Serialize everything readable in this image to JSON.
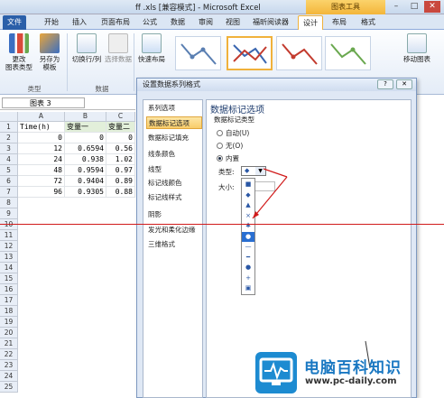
{
  "window": {
    "title": "ff .xls [兼容模式] - Microsoft Excel",
    "chart_tools": "图表工具",
    "minimize": "–",
    "maximize": "□",
    "close": "✕"
  },
  "ribbon_tabs": [
    "文件",
    "开始",
    "插入",
    "页面布局",
    "公式",
    "数据",
    "审阅",
    "视图",
    "福昕阅读器",
    "设计",
    "布局",
    "格式"
  ],
  "ribbon": {
    "change_type": "更改\n图表类型",
    "save_template": "另存为\n模板",
    "switch_rowcol": "切换行/列",
    "select_data": "选择数据",
    "quick_layout": "快速布局",
    "move_chart": "移动图表",
    "group_type": "类型",
    "group_data": "数据"
  },
  "name_box": "图表 3",
  "columns": [
    "A",
    "B",
    "C"
  ],
  "rows": [
    [
      "Time(h)",
      "变量一",
      "变量二"
    ],
    [
      "0",
      "0",
      "0"
    ],
    [
      "12",
      "0.6594",
      "0.56"
    ],
    [
      "24",
      "0.938",
      "1.02"
    ],
    [
      "48",
      "0.9594",
      "0.97"
    ],
    [
      "72",
      "0.9404",
      "0.89"
    ],
    [
      "96",
      "0.9305",
      "0.88"
    ]
  ],
  "row_numbers": [
    "1",
    "2",
    "3",
    "4",
    "5",
    "6",
    "7",
    "8",
    "9",
    "10",
    "11",
    "12",
    "13",
    "14",
    "15",
    "16",
    "17",
    "18",
    "19",
    "20",
    "21",
    "22",
    "23",
    "24",
    "25"
  ],
  "dialog": {
    "title": "设置数据系列格式",
    "help": "?",
    "close": "✕",
    "nav": [
      "系列选项",
      "数据标记选项",
      "数据标记填充",
      "线条颜色",
      "线型",
      "标记线颜色",
      "标记线样式",
      "阴影",
      "发光和柔化边缘",
      "三维格式"
    ],
    "section_title": "数据标记选项",
    "marker_type_label": "数据标记类型",
    "radio": [
      "自动(U)",
      "无(O)",
      "内置"
    ],
    "type_label": "类型:",
    "size_label": "大小:",
    "type_value": "◆",
    "dropdown_items": [
      "■",
      "◆",
      "▲",
      "×",
      "✱",
      "●",
      "—",
      "━",
      "●",
      "+",
      "▣"
    ]
  },
  "watermark": {
    "title": "电脑百科知识",
    "url": "www.pc-daily.com"
  }
}
